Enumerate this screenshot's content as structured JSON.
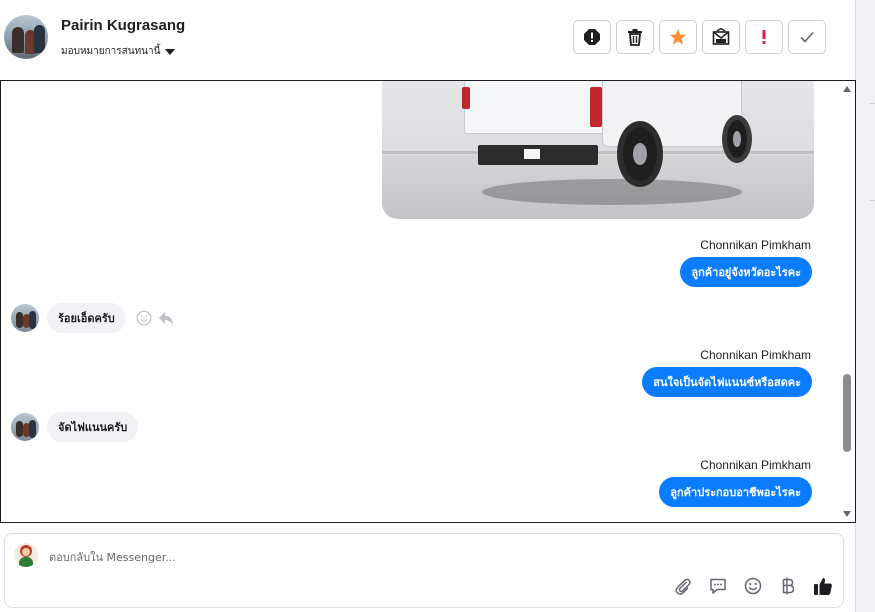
{
  "header": {
    "contact_name": "Pairin Kugrasang",
    "assign_label": "มอบหมายการสนทนานี้"
  },
  "toolbar": {
    "icons": [
      "report-spam-icon",
      "trash-icon",
      "star-icon",
      "mark-unread-icon",
      "important-icon",
      "done-check-icon"
    ],
    "accent": "#f7923a",
    "alert": "#e41e3f"
  },
  "messages": [
    {
      "direction": "out",
      "type": "image",
      "alt": "white pickup truck"
    },
    {
      "direction": "out",
      "sender": "Chonnikan Pimkham",
      "text": "ลูกค้าอยู่จังหวัดอะไรคะ"
    },
    {
      "direction": "in",
      "text": "ร้อยเอ็ดครับ"
    },
    {
      "direction": "out",
      "sender": "Chonnikan Pimkham",
      "text": "สนใจเป็นจัดไฟแนนซ์หรือสดคะ"
    },
    {
      "direction": "in",
      "text": "จัดไฟแนนครับ"
    },
    {
      "direction": "out",
      "sender": "Chonnikan Pimkham",
      "text": "ลูกค้าประกอบอาชีพอะไรคะ"
    }
  ],
  "composer": {
    "placeholder": "ตอบกลับใน Messenger...",
    "icons": [
      "attach-icon",
      "saved-reply-icon",
      "emoji-icon",
      "baht-payment-icon",
      "thumbs-up-icon"
    ]
  },
  "colors": {
    "outgoing_bubble": "#0a7cff",
    "incoming_bubble": "#f0f2f5"
  }
}
